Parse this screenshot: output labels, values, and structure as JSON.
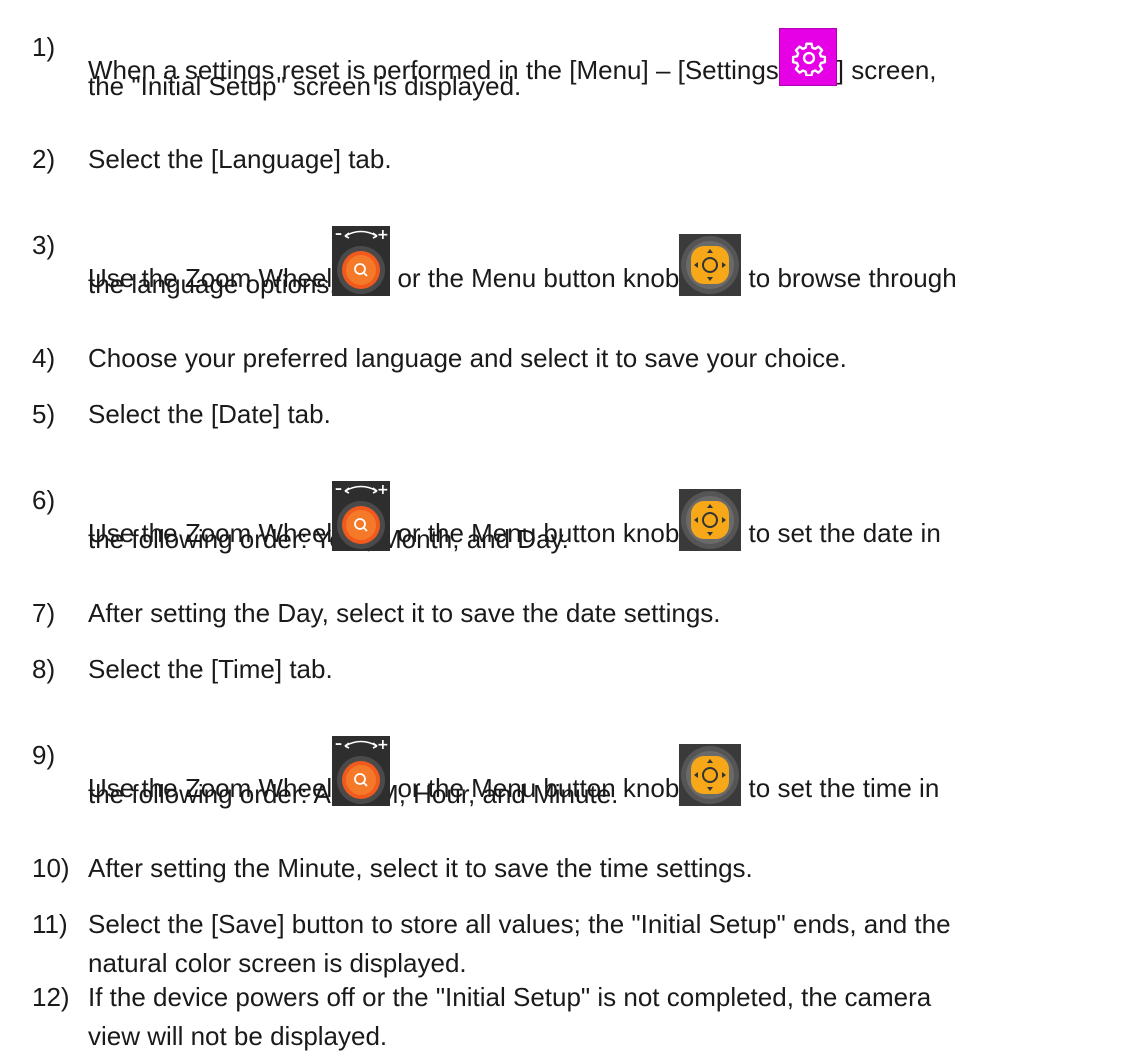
{
  "steps": [
    {
      "number": "1)",
      "lines": [
        {
          "a": "When a settings reset is performed in the [Menu] – [Settings",
          "b": "] screen,"
        },
        {
          "a": "the \"Initial Setup\" screen is displayed."
        }
      ]
    },
    {
      "number": "2)",
      "lines": [
        {
          "a": "Select the [Language] tab."
        }
      ]
    },
    {
      "number": "3)",
      "lines": [
        {
          "a": "Use the Zoom Wheel",
          "b": " or the Menu button knob",
          "c": " to browse through"
        },
        {
          "a": "the language options."
        }
      ]
    },
    {
      "number": "4)",
      "lines": [
        {
          "a": "Choose your preferred language and select it to save your choice."
        }
      ]
    },
    {
      "number": "5)",
      "lines": [
        {
          "a": "Select the [Date] tab."
        }
      ]
    },
    {
      "number": "6)",
      "lines": [
        {
          "a": "Use the Zoom Wheel",
          "b": " or the Menu button knob",
          "c": " to set the date in"
        },
        {
          "a": "the following order: Year, Month, and Day."
        }
      ]
    },
    {
      "number": "7)",
      "lines": [
        {
          "a": "After setting the Day, select it to save the date settings."
        }
      ]
    },
    {
      "number": "8)",
      "lines": [
        {
          "a": "Select the [Time] tab."
        }
      ]
    },
    {
      "number": "9)",
      "lines": [
        {
          "a": "Use the Zoom Wheel",
          "b": " or the Menu button knob",
          "c": " to set the time in"
        },
        {
          "a": "the following order: AM/PM, Hour, and Minute."
        }
      ]
    },
    {
      "number": "10)",
      "lines": [
        {
          "a": "After setting the Minute, select it to save the time settings."
        }
      ]
    },
    {
      "number": "11)",
      "lines": [
        {
          "a": "Select the [Save] button to store all values; the \"Initial Setup\" ends, and the"
        },
        {
          "a": "natural color screen is displayed."
        }
      ]
    },
    {
      "number": "12)",
      "lines": [
        {
          "a": "If the device powers off or the \"Initial Setup\" is not completed, the camera"
        },
        {
          "a": "view will not be displayed."
        }
      ]
    }
  ],
  "icons": {
    "settings": "gear-icon",
    "zoom_wheel": "zoom-wheel-icon",
    "menu_knob": "menu-knob-icon"
  },
  "colors": {
    "settings_icon_bg": "#e600e6",
    "zoom_wheel_orange": "#f25a1d",
    "menu_knob_yellow": "#f7a818",
    "text": "#1a1a1a"
  }
}
